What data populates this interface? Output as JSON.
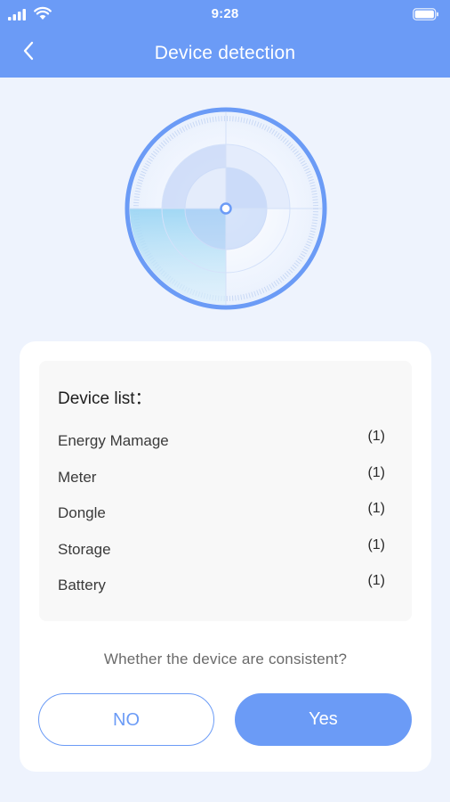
{
  "status_bar": {
    "time": "9:28",
    "icons": [
      "signal-icon",
      "wifi-icon",
      "battery-icon"
    ]
  },
  "header": {
    "title": "Device detection",
    "back_icon": "chevron-left-icon"
  },
  "colors": {
    "accent": "#6b9bf6",
    "background": "#eef3fd",
    "card": "#ffffff",
    "list_background": "#f8f8f8"
  },
  "device_list": {
    "title": "Device list：",
    "items": [
      {
        "name": "Energy Mamage",
        "count": "(1)"
      },
      {
        "name": "Meter",
        "count": "(1)"
      },
      {
        "name": "Dongle",
        "count": "(1)"
      },
      {
        "name": "Storage",
        "count": "(1)"
      },
      {
        "name": "Battery",
        "count": "(1)"
      }
    ]
  },
  "question": "Whether the device are consistent?",
  "buttons": {
    "no": "NO",
    "yes": "Yes"
  }
}
